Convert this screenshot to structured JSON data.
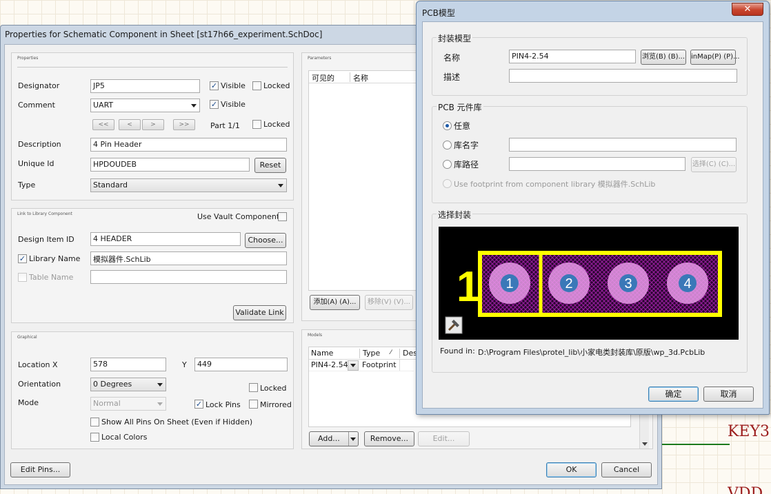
{
  "background": {
    "labels": [
      "KEY3",
      "VDD"
    ]
  },
  "props_dialog": {
    "title": "Properties for Schematic Component in Sheet [st17h66_experiment.SchDoc]",
    "properties": {
      "caption": "Properties",
      "designator_label": "Designator",
      "designator_value": "JP5",
      "comment_label": "Comment",
      "comment_value": "UART",
      "visible_label": "Visible",
      "locked_label": "Locked",
      "nav_first": "<<",
      "nav_prev": "<",
      "nav_next": ">",
      "nav_last": ">>",
      "part_text": "Part 1/1",
      "description_label": "Description",
      "description_value": "4 Pin Header",
      "unique_id_label": "Unique Id",
      "unique_id_value": "HPDOUDEB",
      "reset_button": "Reset",
      "type_label": "Type",
      "type_value": "Standard"
    },
    "library_link": {
      "caption": "Link to Library Component",
      "use_vault_label": "Use Vault Component",
      "design_item_label": "Design Item ID",
      "design_item_value": "4 HEADER",
      "choose_button": "Choose...",
      "library_name_label": "Library Name",
      "library_name_value": "模拟器件.SchLib",
      "table_name_label": "Table Name",
      "table_name_value": "",
      "validate_button": "Validate Link"
    },
    "graphical": {
      "caption": "Graphical",
      "location_label": "Location  X",
      "x_value": "578",
      "y_label": "Y",
      "y_value": "449",
      "orientation_label": "Orientation",
      "orientation_value": "0 Degrees",
      "locked_label": "Locked",
      "mode_label": "Mode",
      "mode_value": "Normal",
      "lock_pins_label": "Lock Pins",
      "mirrored_label": "Mirrored",
      "show_all_pins_label": "Show All Pins On Sheet (Even if Hidden)",
      "local_colors_label": "Local Colors"
    },
    "parameters": {
      "caption": "Parameters",
      "col_visible": "可见的",
      "col_name": "名称",
      "add_button": "添加(A) (A)...",
      "remove_button": "移除(V) (V)..."
    },
    "models": {
      "caption": "Models",
      "col_name": "Name",
      "col_type": "Type",
      "col_desc": "Des",
      "row_name": "PIN4-2.54",
      "row_type": "Footprint",
      "add_button": "Add...",
      "remove_button": "Remove...",
      "edit_button": "Edit..."
    },
    "edit_pins_button": "Edit Pins...",
    "ok_button": "OK",
    "cancel_button": "Cancel"
  },
  "pcb_dialog": {
    "title": "PCB模型",
    "close_symbol": "✕",
    "footprint_model": {
      "caption": "封装模型",
      "name_label": "名称",
      "name_value": "PIN4-2.54",
      "browse_button": "浏览(B) (B)...",
      "pinmap_button": "inMap(P) (P)...",
      "desc_label": "描述",
      "desc_value": ""
    },
    "pcb_library": {
      "caption": "PCB 元件库",
      "any_label": "任意",
      "lib_name_label": "库名字",
      "lib_path_label": "库路径",
      "select_button": "选择(C) (C)...",
      "use_footprint_label": "Use footprint from component library 模拟器件.SchLib"
    },
    "selected_footprint": {
      "caption": "选择封装",
      "pin1_marker": "1",
      "pads": [
        "1",
        "2",
        "3",
        "4"
      ],
      "found_in_label": "Found in:",
      "found_in_path": "D:\\Program Files\\protel_lib\\小家电类封装库\\原版\\wp_3d.PcbLib"
    },
    "ok_button": "确定",
    "cancel_button": "取消"
  },
  "colors": {
    "pcb_background": "#000000",
    "silkscreen": "#ffff00",
    "pad": "#e79ae8",
    "pad_hole": "#3a78b8",
    "hatch": "#9a1ea0"
  }
}
